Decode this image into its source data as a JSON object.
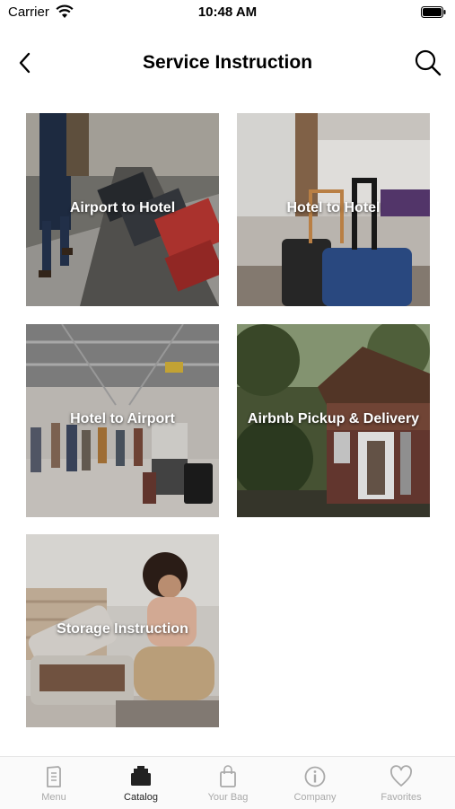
{
  "status": {
    "carrier": "Carrier",
    "time": "10:48 AM"
  },
  "header": {
    "title": "Service Instruction"
  },
  "services": [
    {
      "label": "Airport to Hotel"
    },
    {
      "label": "Hotel to Hotel"
    },
    {
      "label": "Hotel to Airport"
    },
    {
      "label": "Airbnb Pickup & Delivery"
    },
    {
      "label": "Storage Instruction"
    }
  ],
  "tabs": [
    {
      "label": "Menu",
      "icon": "menu-book-icon"
    },
    {
      "label": "Catalog",
      "icon": "catalog-icon",
      "active": true
    },
    {
      "label": "Your Bag",
      "icon": "bag-icon"
    },
    {
      "label": "Company",
      "icon": "info-icon"
    },
    {
      "label": "Favorites",
      "icon": "heart-icon"
    }
  ],
  "colors": {
    "active_tab": "#222222",
    "inactive_tab": "#a9a9a9",
    "tile_label": "#ffffff"
  }
}
